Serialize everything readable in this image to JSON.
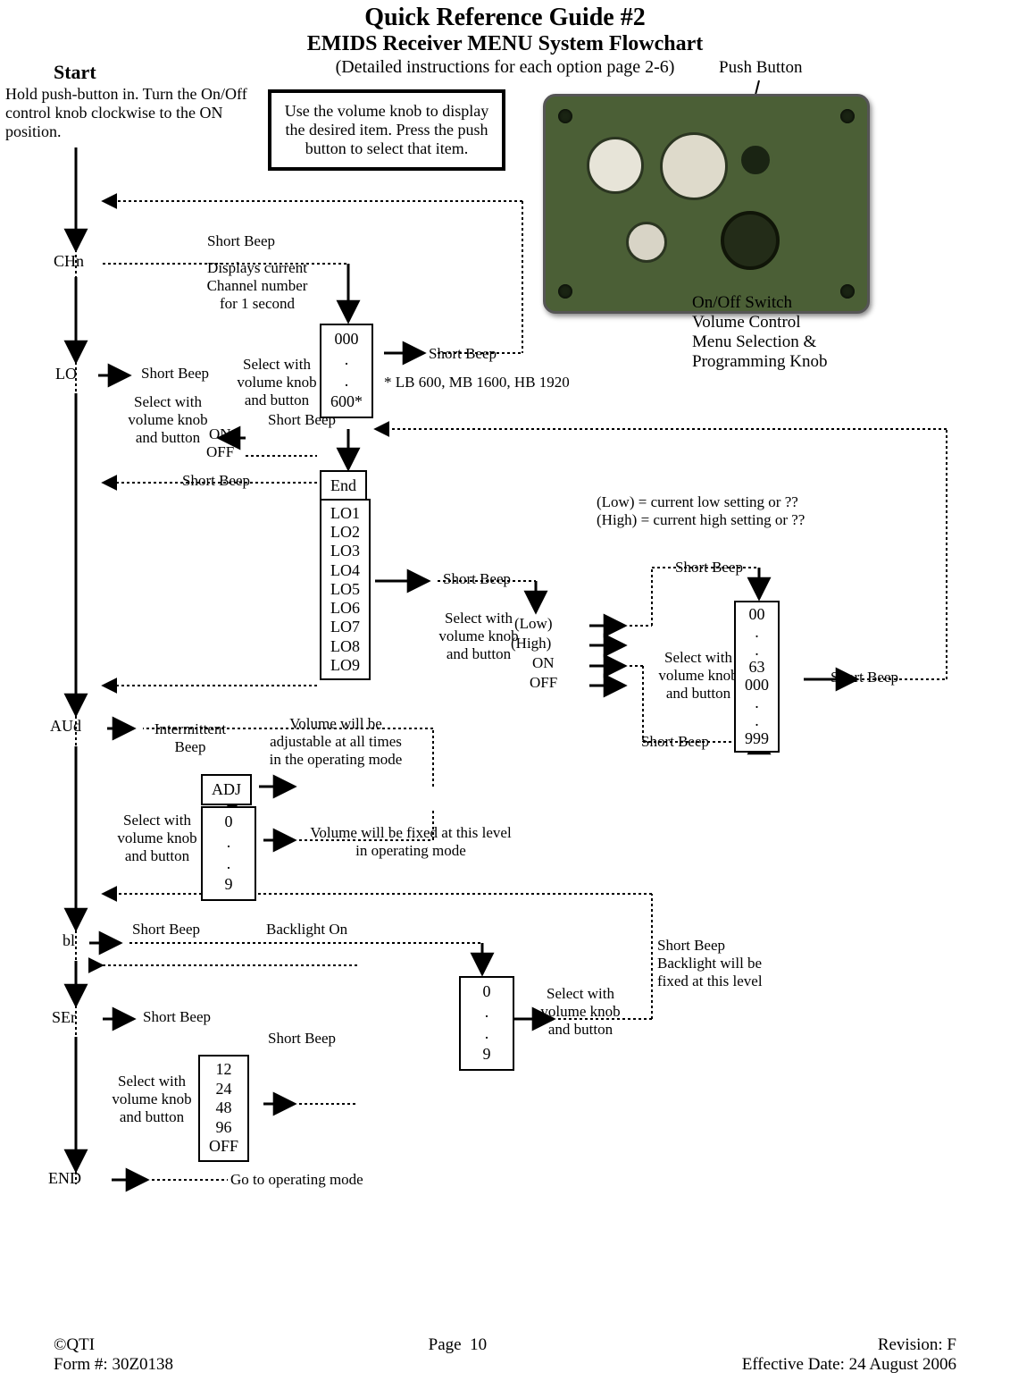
{
  "header": {
    "title1": "Quick Reference Guide #2",
    "title2": "EMIDS Receiver MENU System Flowchart",
    "subtitle": "(Detailed instructions for each option page 2-6)"
  },
  "start": {
    "label": "Start",
    "text": "Hold push-button in. Turn the On/Off control knob clockwise to the ON position."
  },
  "instruction_box": "Use the volume knob to display the desired item. Press the push button to select that item.",
  "device": {
    "push_button_label": "Push Button",
    "knob_label": "On/Off Switch\nVolume Control\nMenu Selection &\nProgramming Knob"
  },
  "menu": {
    "CHn": "CHn",
    "LO": "LO",
    "AUd": "AUd",
    "bl": "bl",
    "SEr": "SEr",
    "END": "END"
  },
  "labels": {
    "short_beep": "Short Beep",
    "disp_channel": "Displays current\nChannel number\nfor 1 second",
    "select": "Select with\nvolume knob\nand button",
    "on": "ON",
    "off": "OFF",
    "end": "End",
    "lb_note": "* LB 600, MB 1600, HB 1920",
    "low_high_note": "(Low) = current low setting or ??\n(High) = current high setting or ??",
    "low": "(Low)",
    "high": "(High)",
    "intermittent_beep": "Intermittent\nBeep",
    "vol_adj_note": "Volume will be\nadjustable at all times\nin the operating mode",
    "vol_fixed_note": "Volume will be fixed at this level\nin operating mode",
    "backlight_on": "Backlight On",
    "backlight_fixed": "Short Beep\nBacklight will be\nfixed at this level",
    "goto_op": "Go to operating mode"
  },
  "boxes": {
    "chn_values": "000\n.\n.\n600*",
    "lo_list": "LO1\nLO2\nLO3\nLO4\nLO5\nLO6\nLO7\nLO8\nLO9",
    "lo_range_low": "00\n.\n.\n63",
    "lo_range_high": "000\n.\n.\n999",
    "lo_range_combined": "00\n.\n.\n63\n000\n.\n.\n999",
    "aud_adj": "ADJ",
    "aud_vals": "0\n.\n.\n9",
    "bl_vals": "0\n.\n.\n9",
    "ser_vals": "12\n24\n48\n96\nOFF"
  },
  "footer": {
    "left": "©QTI\nForm #: 30Z0138",
    "center": "Page  10",
    "right": "Revision: F\nEffective Date: 24 August 2006"
  }
}
